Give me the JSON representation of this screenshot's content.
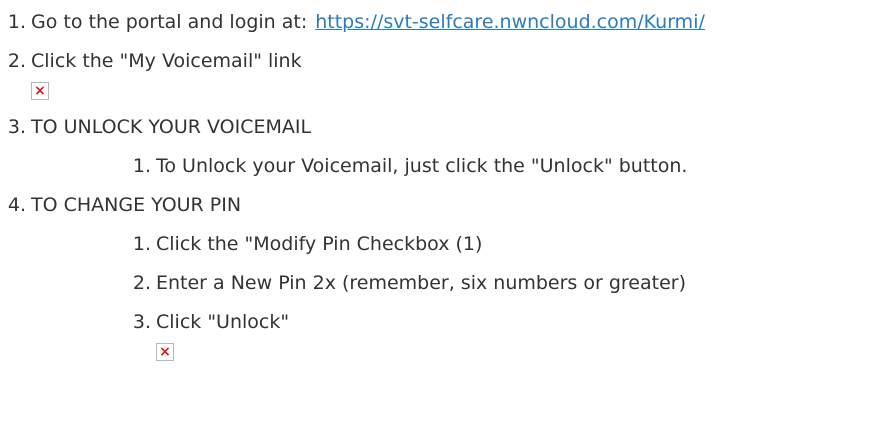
{
  "steps": [
    {
      "number": "1.",
      "text": "Go to the portal and login at:",
      "link": "https://svt-selfcare.nwncloud.com/Kurmi/"
    },
    {
      "number": "2.",
      "text": "Click the \"My Voicemail\" link"
    },
    {
      "number": "3.",
      "text": "TO UNLOCK YOUR VOICEMAIL",
      "substeps": [
        {
          "number": "1.",
          "text": "To Unlock your Voicemail, just click the \"Unlock\" button."
        }
      ]
    },
    {
      "number": "4.",
      "text": "TO CHANGE YOUR PIN",
      "substeps": [
        {
          "number": "1.",
          "text": "Click the \"Modify Pin Checkbox (1)"
        },
        {
          "number": "2.",
          "text": "Enter a New Pin 2x (remember, six numbers or greater)"
        },
        {
          "number": "3.",
          "text": "Click \"Unlock\""
        }
      ]
    }
  ],
  "icons": {
    "broken_image": "broken-image-icon",
    "broken_image_color": "#d01a1a"
  },
  "colors": {
    "text": "#333333",
    "link": "#2a7bc0"
  }
}
